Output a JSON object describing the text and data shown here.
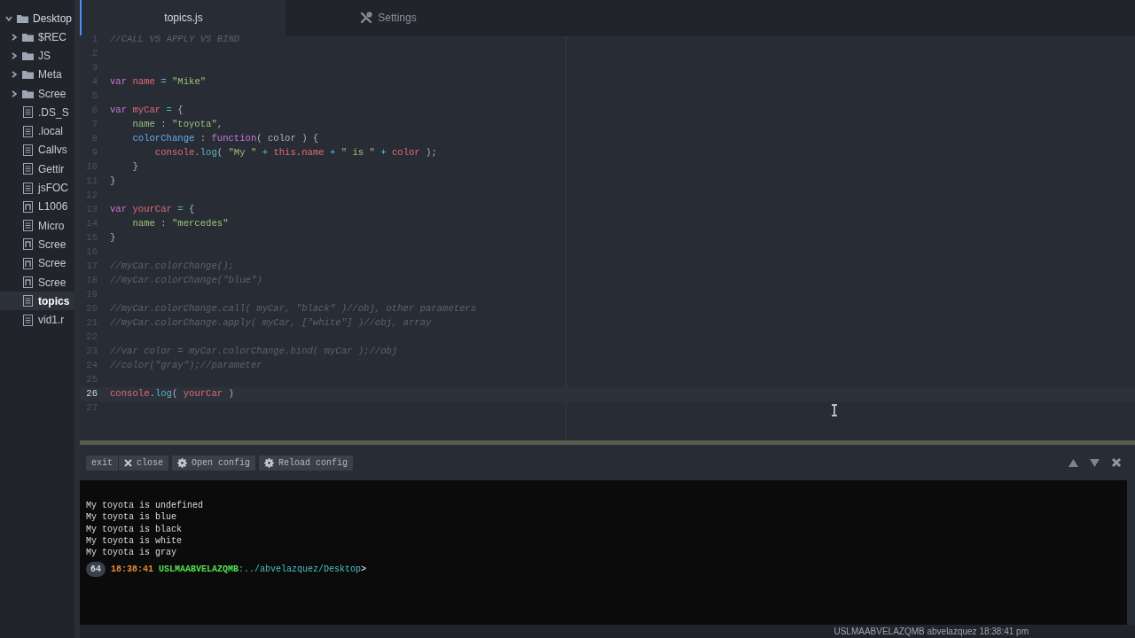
{
  "sidebar": {
    "root": {
      "label": "Desktop",
      "expanded": true,
      "children": [
        {
          "label": "$REC",
          "kind": "folder",
          "selected": false
        },
        {
          "label": "JS",
          "kind": "folder",
          "selected": false
        },
        {
          "label": "Meta",
          "kind": "folder",
          "selected": false
        },
        {
          "label": "Scree",
          "kind": "folder",
          "selected": false
        },
        {
          "label": ".DS_S",
          "kind": "file",
          "selected": false
        },
        {
          "label": ".local",
          "kind": "file",
          "selected": false
        },
        {
          "label": "Callvs",
          "kind": "file",
          "selected": false
        },
        {
          "label": "Gettir",
          "kind": "file",
          "selected": false
        },
        {
          "label": "jsFOC",
          "kind": "file",
          "selected": false
        },
        {
          "label": "L1006",
          "kind": "media",
          "selected": false
        },
        {
          "label": "Micro",
          "kind": "file",
          "selected": false
        },
        {
          "label": "Scree",
          "kind": "media",
          "selected": false
        },
        {
          "label": "Scree",
          "kind": "media",
          "selected": false
        },
        {
          "label": "Scree",
          "kind": "media",
          "selected": false
        },
        {
          "label": "topics",
          "kind": "file",
          "selected": true
        },
        {
          "label": "vid1.r",
          "kind": "file",
          "selected": false
        }
      ]
    }
  },
  "tabs": [
    {
      "label": "topics.js",
      "kind": "file",
      "selected": true
    },
    {
      "label": "Settings",
      "kind": "settings",
      "selected": false
    }
  ],
  "editor": {
    "lines": [
      {
        "number": "1",
        "current": false,
        "tokens": [
          {
            "text": "//CALL VS APPLY VS BIND",
            "kind": "comment"
          }
        ]
      },
      {
        "number": "2",
        "current": false
      },
      {
        "number": "3",
        "current": false
      },
      {
        "number": "4",
        "current": false,
        "tokens": [
          {
            "text": "var",
            "kind": "keyword"
          },
          {
            "text": " name",
            "kind": "variable"
          },
          {
            "text": " =",
            "kind": "operator"
          },
          {
            "text": " \"Mike\"",
            "kind": "string"
          }
        ]
      },
      {
        "number": "5",
        "current": false
      },
      {
        "number": "6",
        "current": false,
        "tokens": [
          {
            "text": "var",
            "kind": "keyword"
          },
          {
            "text": " myCar",
            "kind": "variable"
          },
          {
            "text": " =",
            "kind": "operator"
          },
          {
            "text": " {",
            "kind": "punct"
          }
        ]
      },
      {
        "number": "7",
        "current": false,
        "tokens": [
          {
            "text": "    name",
            "kind": "property"
          },
          {
            "text": " : ",
            "kind": "punct"
          },
          {
            "text": "\"toyota\"",
            "kind": "string"
          },
          {
            "text": ",",
            "kind": "punct"
          }
        ]
      },
      {
        "number": "8",
        "current": false,
        "tokens": [
          {
            "text": "    colorChange",
            "kind": "function-name"
          },
          {
            "text": " : ",
            "kind": "punct"
          },
          {
            "text": "function",
            "kind": "keyword"
          },
          {
            "text": "( color ) {",
            "kind": "punct"
          }
        ]
      },
      {
        "number": "9",
        "current": false,
        "tokens": [
          {
            "text": "        console",
            "kind": "variable"
          },
          {
            "text": ".",
            "kind": "punct"
          },
          {
            "text": "log",
            "kind": "method"
          },
          {
            "text": "( ",
            "kind": "punct"
          },
          {
            "text": "\"My \"",
            "kind": "string"
          },
          {
            "text": " +",
            "kind": "operator"
          },
          {
            "text": " this",
            "kind": "variable"
          },
          {
            "text": ".",
            "kind": "punct"
          },
          {
            "text": "name",
            "kind": "variable"
          },
          {
            "text": " +",
            "kind": "operator"
          },
          {
            "text": " \" is \"",
            "kind": "string"
          },
          {
            "text": " +",
            "kind": "operator"
          },
          {
            "text": " color",
            "kind": "variable"
          },
          {
            "text": " );",
            "kind": "punct"
          }
        ]
      },
      {
        "number": "10",
        "current": false,
        "tokens": [
          {
            "text": "    }",
            "kind": "punct"
          }
        ]
      },
      {
        "number": "11",
        "current": false,
        "tokens": [
          {
            "text": "}",
            "kind": "punct"
          }
        ]
      },
      {
        "number": "12",
        "current": false
      },
      {
        "number": "13",
        "current": false,
        "tokens": [
          {
            "text": "var",
            "kind": "keyword"
          },
          {
            "text": " yourCar",
            "kind": "variable"
          },
          {
            "text": " =",
            "kind": "operator"
          },
          {
            "text": " {",
            "kind": "punct"
          }
        ]
      },
      {
        "number": "14",
        "current": false,
        "tokens": [
          {
            "text": "    name",
            "kind": "property"
          },
          {
            "text": " : ",
            "kind": "punct"
          },
          {
            "text": "\"mercedes\"",
            "kind": "string"
          }
        ]
      },
      {
        "number": "15",
        "current": false,
        "tokens": [
          {
            "text": "}",
            "kind": "punct"
          }
        ]
      },
      {
        "number": "16",
        "current": false
      },
      {
        "number": "17",
        "current": false,
        "tokens": [
          {
            "text": "//myCar.colorChange();",
            "kind": "comment"
          }
        ]
      },
      {
        "number": "18",
        "current": false,
        "tokens": [
          {
            "text": "//myCar.colorChange(\"blue\")",
            "kind": "comment"
          }
        ]
      },
      {
        "number": "19",
        "current": false
      },
      {
        "number": "20",
        "current": false,
        "tokens": [
          {
            "text": "//myCar.colorChange.call( myCar, \"black\" )//obj, other parameters",
            "kind": "comment"
          }
        ]
      },
      {
        "number": "21",
        "current": false,
        "tokens": [
          {
            "text": "//myCar.colorChange.apply( myCar, [\"white\"] )//obj, array",
            "kind": "comment"
          }
        ]
      },
      {
        "number": "22",
        "current": false
      },
      {
        "number": "23",
        "current": false,
        "tokens": [
          {
            "text": "//var color = myCar.colorChange.bind( myCar );//obj",
            "kind": "comment"
          }
        ]
      },
      {
        "number": "24",
        "current": false,
        "tokens": [
          {
            "text": "//color(\"gray\");//parameter",
            "kind": "comment"
          }
        ]
      },
      {
        "number": "25",
        "current": false
      },
      {
        "number": "26",
        "current": true,
        "tokens": [
          {
            "text": "console",
            "kind": "variable"
          },
          {
            "text": ".",
            "kind": "punct"
          },
          {
            "text": "log",
            "kind": "method"
          },
          {
            "text": "( ",
            "kind": "punct"
          },
          {
            "text": "yourCar",
            "kind": "variable"
          },
          {
            "text": " )",
            "kind": "punct"
          }
        ]
      },
      {
        "number": "27",
        "current": false
      }
    ]
  },
  "terminal": {
    "buttons": [
      {
        "label": "exit",
        "kind": "plain"
      },
      {
        "label": "close",
        "kind": "close"
      },
      {
        "label": "Open config",
        "kind": "config"
      },
      {
        "label": "Reload config",
        "kind": "config"
      }
    ],
    "output": [
      "My toyota is undefined",
      "My toyota is blue",
      "My toyota is black",
      "My toyota is white",
      "My toyota is gray"
    ],
    "prompt": {
      "count": "64",
      "time": "18:38:41",
      "host": "USLMAABVELAZQMB",
      "path": ":../abvelazquez/Desktop",
      "symbol": ">"
    }
  },
  "status_bar": {
    "text": "USLMAABVELAZQMB abvelazquez 18:38:41 pm"
  }
}
